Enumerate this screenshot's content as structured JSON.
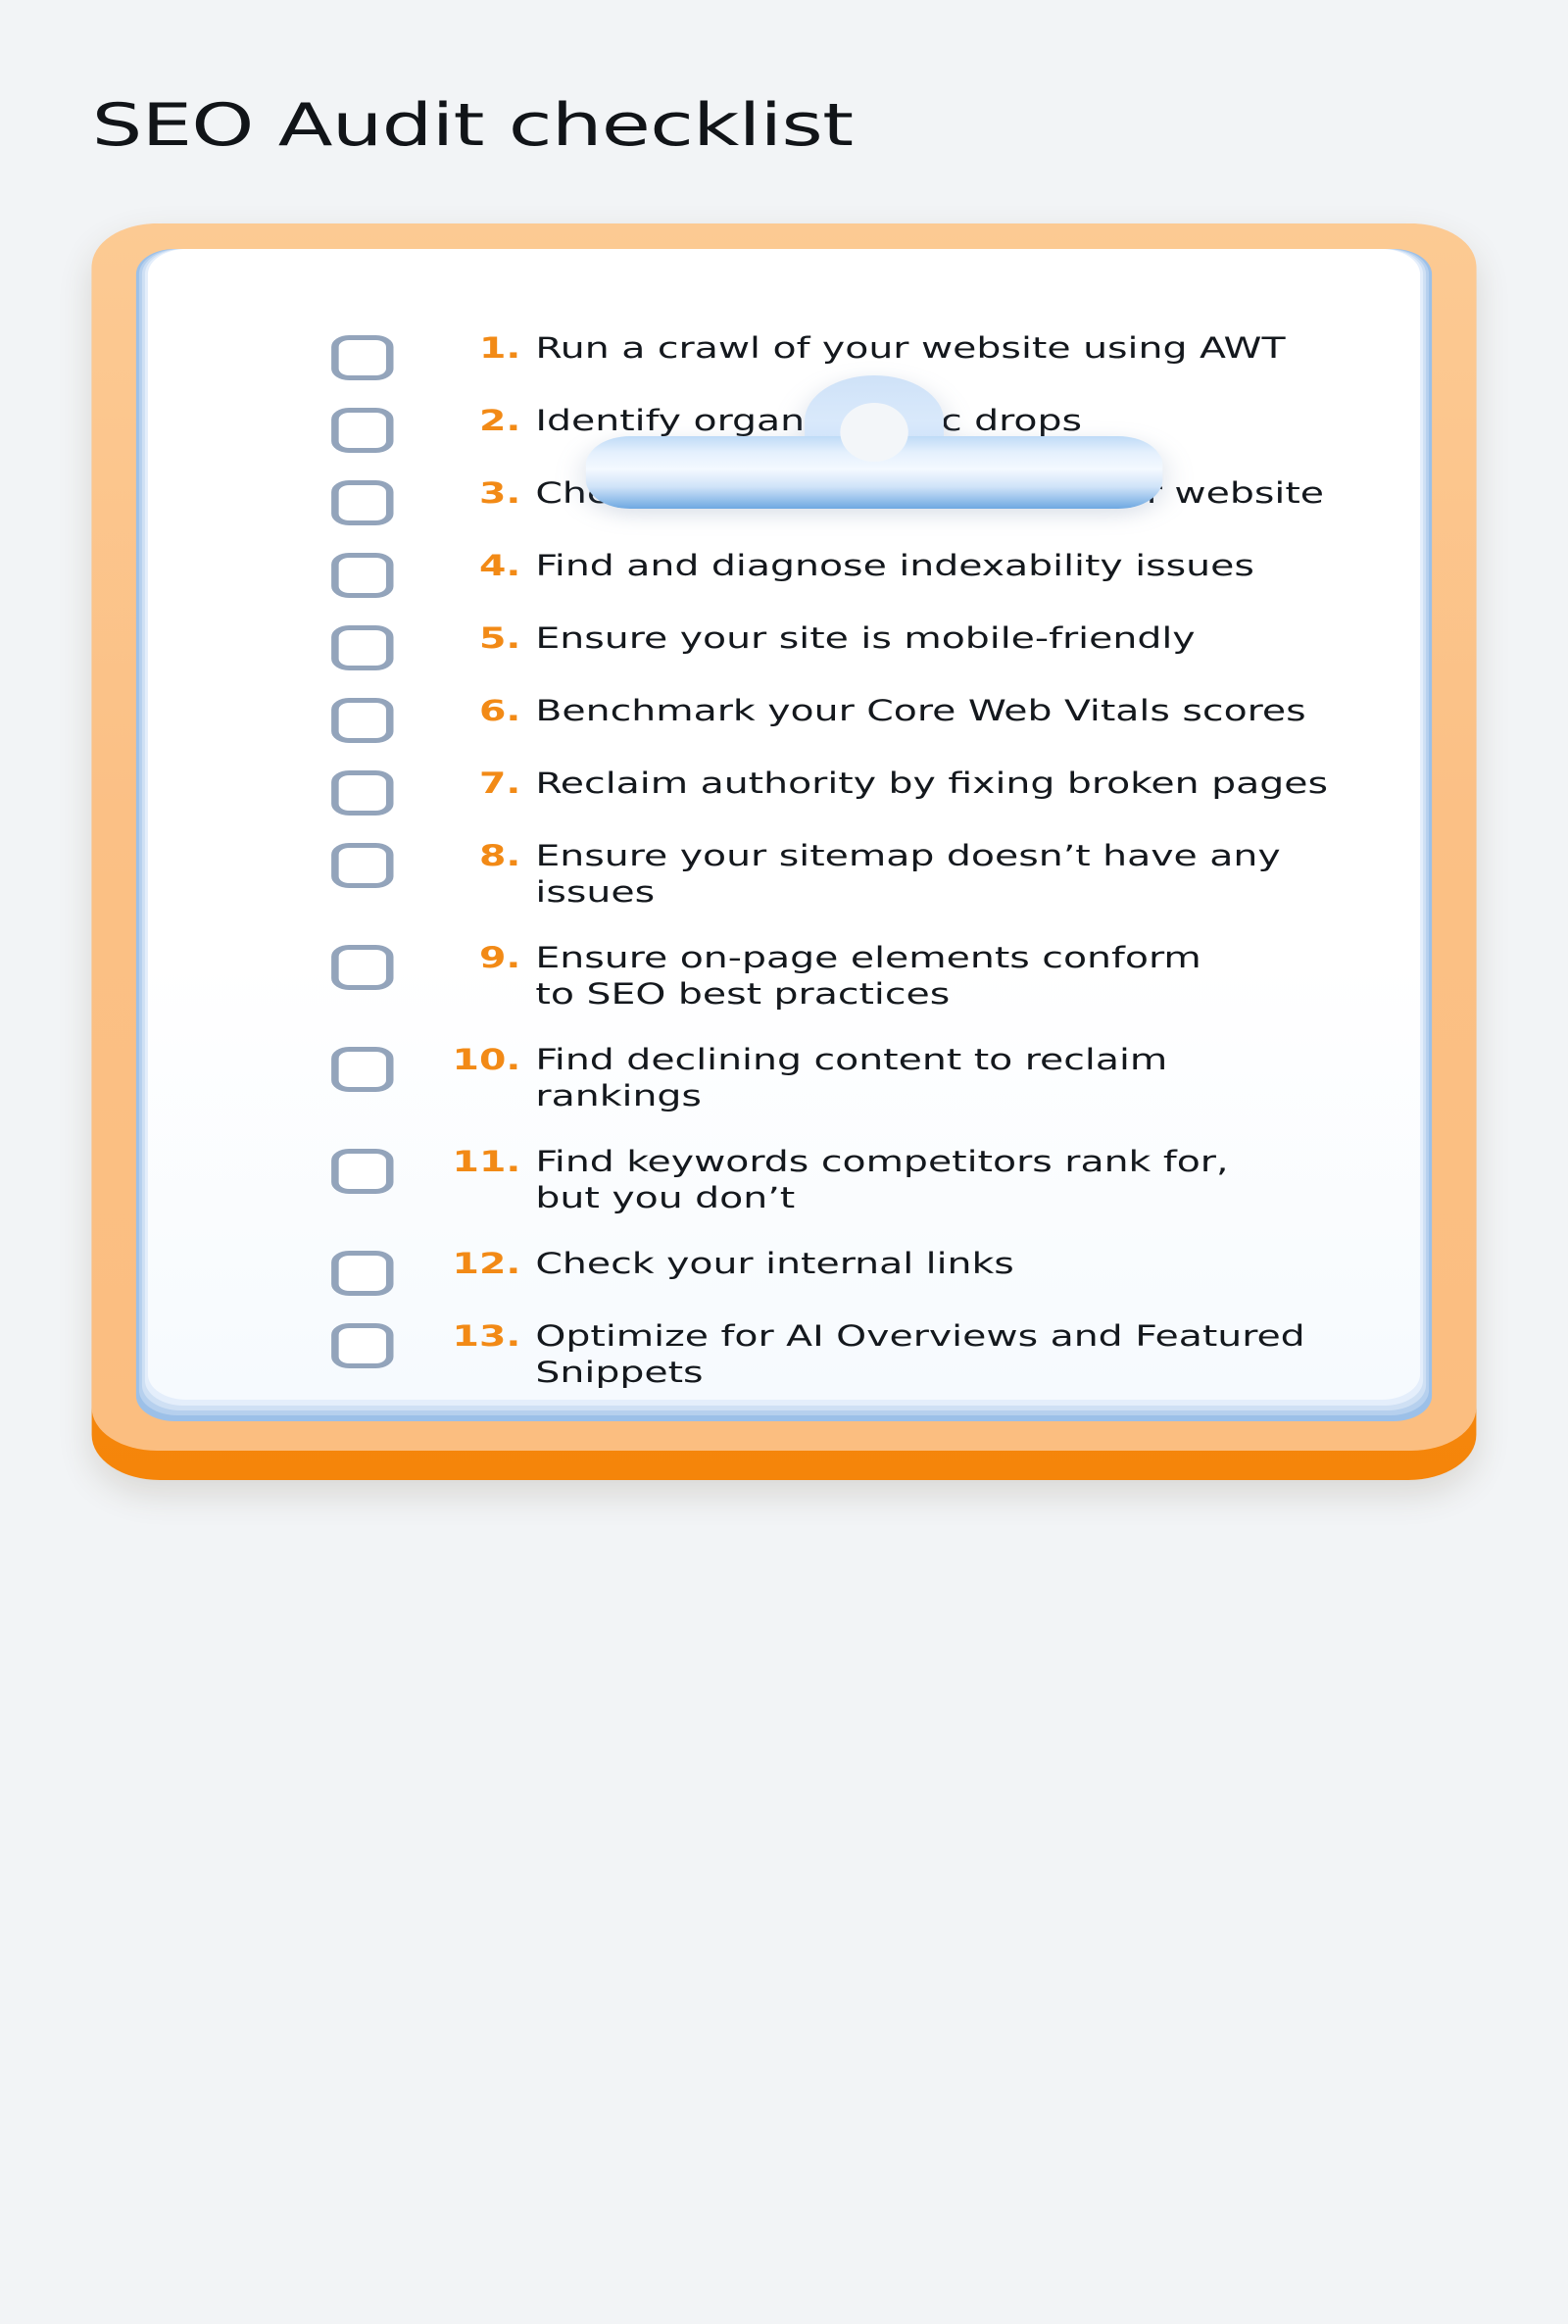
{
  "page": {
    "title": "SEO Audit checklist",
    "background_color": "#f2f4f6"
  },
  "theme": {
    "accent_orange": "#f28a16",
    "board_orange": "#fbc085",
    "board_edge_orange": "#f5850a",
    "checkbox_border": "#93a4bb",
    "clip_blue_light": "#dbeafe",
    "clip_blue_dark": "#6fa8e0",
    "text_color": "#14181d",
    "paper_white": "#ffffff"
  },
  "clipboard": {
    "clip_icon": "clipboard-clip",
    "paper_sheets": 5
  },
  "checklist": {
    "items": [
      {
        "number": "1.",
        "label": "Run a crawl of your website using AWT",
        "checked": false
      },
      {
        "number": "2.",
        "label": "Identify organic traffic drops",
        "checked": false
      },
      {
        "number": "3.",
        "label": "Check for any duplicates of your website",
        "checked": false
      },
      {
        "number": "4.",
        "label": "Find and diagnose indexability issues",
        "checked": false
      },
      {
        "number": "5.",
        "label": "Ensure your site is mobile-friendly",
        "checked": false
      },
      {
        "number": "6.",
        "label": "Benchmark your Core Web Vitals scores",
        "checked": false
      },
      {
        "number": "7.",
        "label": "Reclaim authority by fixing broken pages",
        "checked": false
      },
      {
        "number": "8.",
        "label": "Ensure your sitemap doesn’t have any\nissues",
        "checked": false
      },
      {
        "number": "9.",
        "label": "Ensure on-page elements conform\nto SEO best practices",
        "checked": false
      },
      {
        "number": "10.",
        "label": "Find declining content to reclaim\nrankings",
        "checked": false
      },
      {
        "number": "11.",
        "label": "Find keywords competitors rank for,\nbut you don’t",
        "checked": false
      },
      {
        "number": "12.",
        "label": "Check your internal links",
        "checked": false
      },
      {
        "number": "13.",
        "label": "Optimize for AI Overviews and Featured\nSnippets",
        "checked": false
      }
    ]
  }
}
